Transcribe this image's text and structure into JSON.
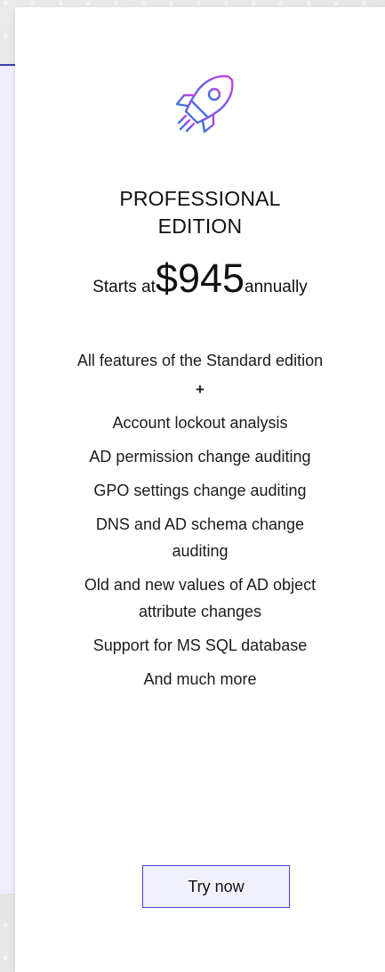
{
  "plan": {
    "icon": "rocket-icon",
    "title_line1": "PROFESSIONAL",
    "title_line2": "EDITION",
    "price_prefix": "Starts at",
    "price_amount": "$945",
    "price_suffix": "annually",
    "features": [
      "All features of the Standard edition",
      "+",
      "Account lockout analysis",
      "AD permission change auditing",
      "GPO settings change auditing",
      "DNS and AD schema change auditing",
      "Old and new values of AD object attribute changes",
      "Support for MS SQL database",
      "And much more"
    ],
    "cta_label": "Try now"
  },
  "colors": {
    "accent": "#4a47b8",
    "button_bg": "#f1f0fd",
    "left_panel_bg": "#efeefe",
    "left_panel_border": "#3f3db0",
    "rocket_gradient_start": "#2a7bdf",
    "rocket_gradient_end": "#d13fe3"
  }
}
